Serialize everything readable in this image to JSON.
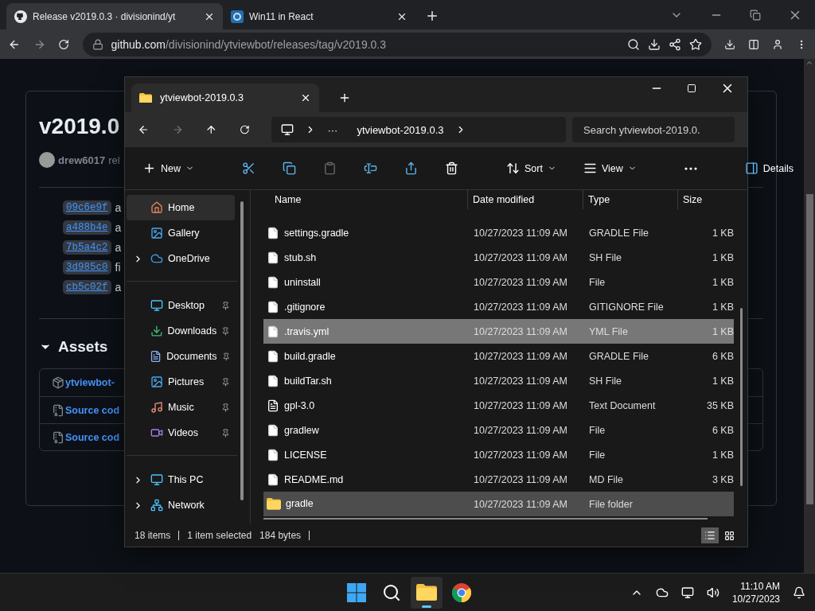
{
  "browser": {
    "tabs": [
      {
        "title": "Release v2019.0.3 · divisionind/yt",
        "kind": "github",
        "selected": true
      },
      {
        "title": "Win11 in React",
        "kind": "app",
        "selected": false
      }
    ],
    "url": {
      "host": "github.com",
      "path": "/divisionind/ytviewbot/releases/tag/v2019.0.3"
    }
  },
  "github": {
    "release_title": "v2019.0",
    "author": "drew6017",
    "author_suffix": "rel",
    "commits": [
      {
        "sha": "09c6e9f",
        "text": "a"
      },
      {
        "sha": "a488b4e",
        "text": "a"
      },
      {
        "sha": "7b5a4c2",
        "text": "a"
      },
      {
        "sha": "3d985c0",
        "text": "fi"
      },
      {
        "sha": "cb5c02f",
        "text": "a"
      }
    ],
    "assets": {
      "title": "Assets",
      "items": [
        {
          "kind": "package",
          "label": "ytviewbot-"
        },
        {
          "kind": "zip",
          "label": "Source cod"
        },
        {
          "kind": "zip",
          "label": "Source cod"
        }
      ]
    }
  },
  "explorer": {
    "tab_title": "ytviewbot-2019.0.3",
    "overflow": "···",
    "breadcrumb": "ytviewbot-2019.0.3",
    "search": {
      "placeholder": "Search ytviewbot-2019.0."
    },
    "commands": [
      {
        "kind": "new",
        "label": "New"
      },
      {
        "kind": "cut"
      },
      {
        "kind": "copy"
      },
      {
        "kind": "paste",
        "disabled": true
      },
      {
        "kind": "rename"
      },
      {
        "kind": "share"
      },
      {
        "kind": "delete"
      },
      {
        "kind": "sort",
        "label": "Sort"
      },
      {
        "kind": "view",
        "label": "View"
      },
      {
        "kind": "more"
      },
      {
        "kind": "details",
        "label": "Details"
      }
    ],
    "sidebar": [
      [
        {
          "label": "Home",
          "expandable": false,
          "pinned": false,
          "selected": true
        },
        {
          "label": "Gallery",
          "expandable": false,
          "pinned": false,
          "selected": false
        },
        {
          "label": "OneDrive",
          "expandable": true,
          "pinned": false,
          "selected": false
        }
      ],
      [
        {
          "label": "Desktop",
          "expandable": false,
          "pinned": true,
          "selected": false
        },
        {
          "label": "Downloads",
          "expandable": false,
          "pinned": true,
          "selected": false
        },
        {
          "label": "Documents",
          "expandable": false,
          "pinned": true,
          "selected": false
        },
        {
          "label": "Pictures",
          "expandable": false,
          "pinned": true,
          "selected": false
        },
        {
          "label": "Music",
          "expandable": false,
          "pinned": true,
          "selected": false
        },
        {
          "label": "Videos",
          "expandable": false,
          "pinned": true,
          "selected": false
        }
      ],
      [
        {
          "label": "This PC",
          "expandable": true,
          "pinned": false,
          "selected": false
        },
        {
          "label": "Network",
          "expandable": true,
          "pinned": false,
          "selected": false
        }
      ]
    ],
    "columns": [
      "Name",
      "Date modified",
      "Type",
      "Size"
    ],
    "rows": [
      {
        "kind": "file",
        "name": "settings.gradle",
        "date": "10/27/2023 11:09 AM",
        "type": "GRADLE File",
        "size": "1 KB",
        "selected": false,
        "hovered": false
      },
      {
        "kind": "file",
        "name": "stub.sh",
        "date": "10/27/2023 11:09 AM",
        "type": "SH File",
        "size": "1 KB",
        "selected": false,
        "hovered": false
      },
      {
        "kind": "file",
        "name": "uninstall",
        "date": "10/27/2023 11:09 AM",
        "type": "File",
        "size": "1 KB",
        "selected": false,
        "hovered": false
      },
      {
        "kind": "file",
        "name": ".gitignore",
        "date": "10/27/2023 11:09 AM",
        "type": "GITIGNORE File",
        "size": "1 KB",
        "selected": false,
        "hovered": false
      },
      {
        "kind": "file",
        "name": ".travis.yml",
        "date": "10/27/2023 11:09 AM",
        "type": "YML File",
        "size": "1 KB",
        "selected": true,
        "hovered": false
      },
      {
        "kind": "file",
        "name": "build.gradle",
        "date": "10/27/2023 11:09 AM",
        "type": "GRADLE File",
        "size": "6 KB",
        "selected": false,
        "hovered": false
      },
      {
        "kind": "file",
        "name": "buildTar.sh",
        "date": "10/27/2023 11:09 AM",
        "type": "SH File",
        "size": "1 KB",
        "selected": false,
        "hovered": false
      },
      {
        "kind": "text",
        "name": "gpl-3.0",
        "date": "10/27/2023 11:09 AM",
        "type": "Text Document",
        "size": "35 KB",
        "selected": false,
        "hovered": false
      },
      {
        "kind": "file",
        "name": "gradlew",
        "date": "10/27/2023 11:09 AM",
        "type": "File",
        "size": "6 KB",
        "selected": false,
        "hovered": false
      },
      {
        "kind": "file",
        "name": "LICENSE",
        "date": "10/27/2023 11:09 AM",
        "type": "File",
        "size": "1 KB",
        "selected": false,
        "hovered": false
      },
      {
        "kind": "file",
        "name": "README.md",
        "date": "10/27/2023 11:09 AM",
        "type": "MD File",
        "size": "3 KB",
        "selected": false,
        "hovered": false
      },
      {
        "kind": "folder",
        "name": "gradle",
        "date": "10/27/2023 11:09 AM",
        "type": "File folder",
        "selected": false,
        "hovered": true
      }
    ],
    "status": {
      "count": "18 items",
      "selection": "1 item selected",
      "bytes": "184 bytes"
    },
    "views": [
      {
        "kind": "details",
        "selected": true
      },
      {
        "kind": "tiles",
        "selected": false
      }
    ]
  },
  "taskbar": {
    "apps": [
      {
        "kind": "start",
        "active": false
      },
      {
        "kind": "search",
        "active": false
      },
      {
        "kind": "explorer",
        "active": true
      },
      {
        "kind": "chrome",
        "active": false
      }
    ],
    "time": "11:10 AM",
    "date": "10/27/2023"
  }
}
